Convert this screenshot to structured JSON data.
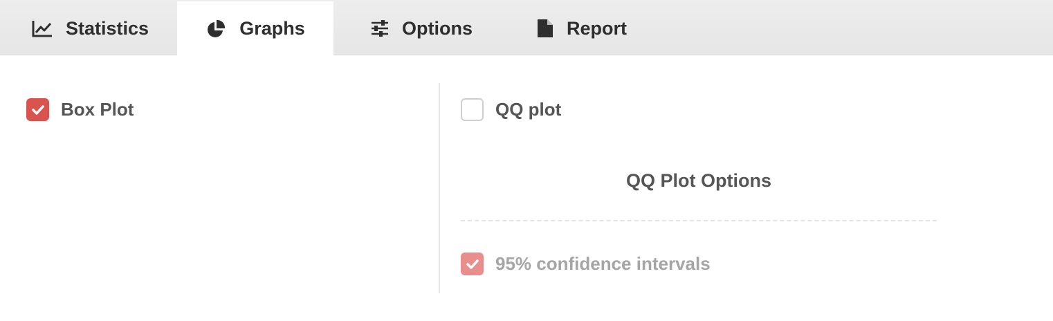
{
  "tabs": [
    {
      "label": "Statistics",
      "icon": "line-chart-icon"
    },
    {
      "label": "Graphs",
      "icon": "pie-chart-icon",
      "active": true
    },
    {
      "label": "Options",
      "icon": "sliders-icon"
    },
    {
      "label": "Report",
      "icon": "document-icon"
    }
  ],
  "left": {
    "box_plot": {
      "label": "Box Plot",
      "checked": true
    }
  },
  "right": {
    "qq_plot": {
      "label": "QQ plot",
      "checked": false
    },
    "options_title": "QQ Plot Options",
    "confidence": {
      "label": "95% confidence intervals",
      "checked": true,
      "disabled": true
    }
  },
  "colors": {
    "accent": "#d9534f",
    "accent_disabled": "#e88e8c",
    "tabbar_bg": "#e8e8e8",
    "text": "#555555"
  }
}
